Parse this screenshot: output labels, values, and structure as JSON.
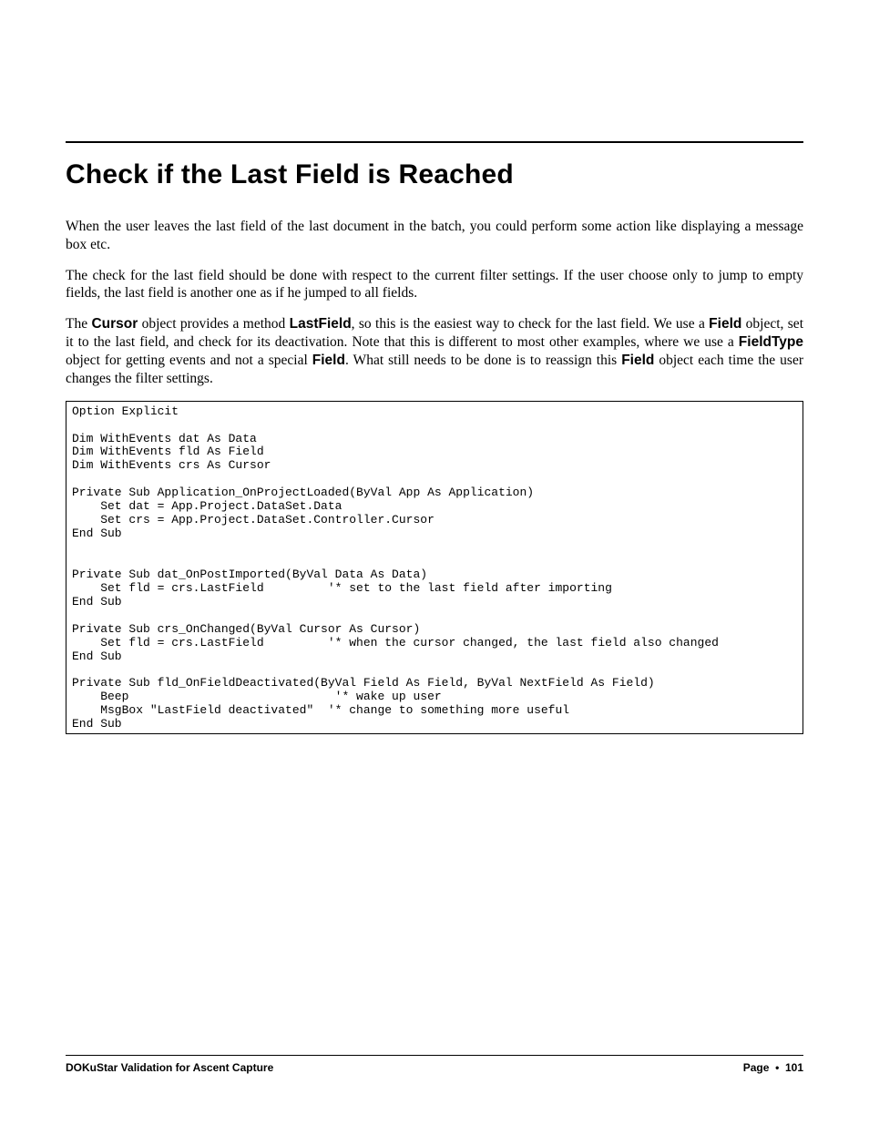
{
  "title": "Check if the Last Field is Reached",
  "para1": "When the user leaves the last field of the last document in the batch, you could perform some action like displaying a message box etc.",
  "para2": "The check for the last field should be done with respect to the current filter settings. If the user choose only to jump to empty fields, the last field is another one as if he jumped to all fields.",
  "p3": {
    "s1": "The ",
    "kw1": "Cursor",
    "s2": " object provides a method ",
    "kw2": "LastField",
    "s3": ", so this is the easiest way to check for the last field. We use a ",
    "kw3": "Field",
    "s4": " object, set it to the last field, and check for its deactivation. Note that this is different to most other examples, where we use a ",
    "kw4": "FieldType",
    "s5": " object for getting events and not a special ",
    "kw5": "Field",
    "s6": ". What still needs to be done is to reassign this ",
    "kw6": "Field",
    "s7": " object each time the user changes the filter settings."
  },
  "code": "Option Explicit\n\nDim WithEvents dat As Data\nDim WithEvents fld As Field\nDim WithEvents crs As Cursor\n\nPrivate Sub Application_OnProjectLoaded(ByVal App As Application)\n    Set dat = App.Project.DataSet.Data\n    Set crs = App.Project.DataSet.Controller.Cursor\nEnd Sub\n\n\nPrivate Sub dat_OnPostImported(ByVal Data As Data)\n    Set fld = crs.LastField         '* set to the last field after importing\nEnd Sub\n\nPrivate Sub crs_OnChanged(ByVal Cursor As Cursor)\n    Set fld = crs.LastField         '* when the cursor changed, the last field also changed\nEnd Sub\n\nPrivate Sub fld_OnFieldDeactivated(ByVal Field As Field, ByVal NextField As Field)\n    Beep                             '* wake up user\n    MsgBox \"LastField deactivated\"  '* change to something more useful\nEnd Sub",
  "footer": {
    "left": "DOKuStar Validation for Ascent Capture",
    "rightLabel": "Page",
    "bullet": "•",
    "pageNum": "101"
  }
}
